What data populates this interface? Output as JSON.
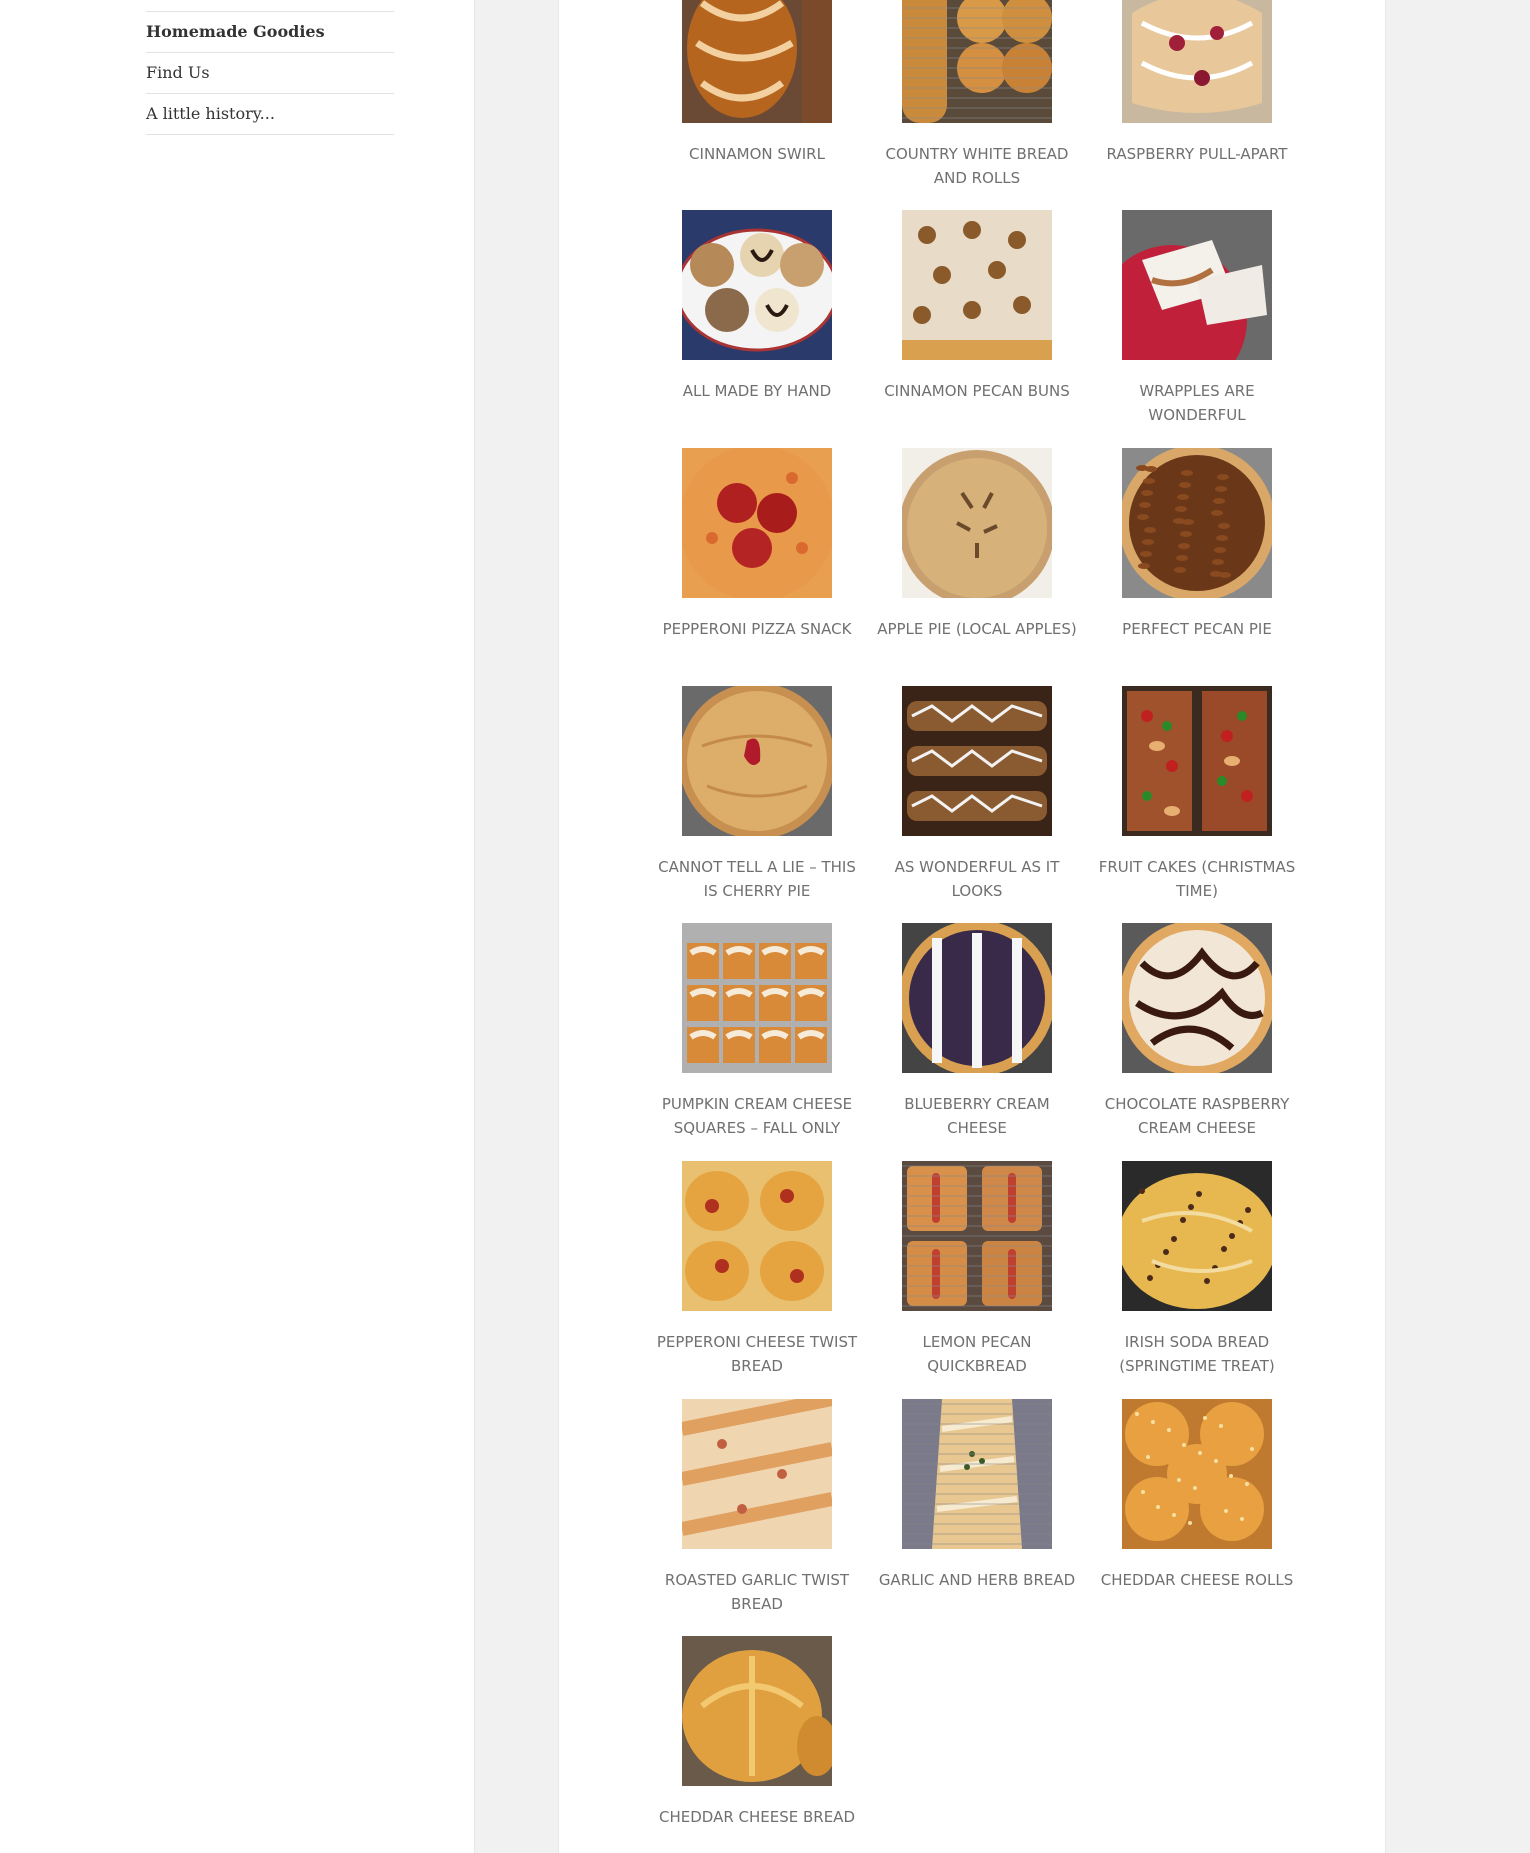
{
  "nav": {
    "items": [
      {
        "label": "Homemade Goodies",
        "current": true
      },
      {
        "label": "Find Us",
        "current": false
      },
      {
        "label": "A little history...",
        "current": false
      }
    ]
  },
  "gallery": {
    "items": [
      {
        "caption": "Cinnamon swirl",
        "icon": "cinnamon-swirl-photo"
      },
      {
        "caption": "Country white bread and rolls",
        "icon": "country-white-bread-photo"
      },
      {
        "caption": "Raspberry pull-apart",
        "icon": "raspberry-pull-apart-photo"
      },
      {
        "caption": "All made by hand",
        "icon": "cookies-plate-photo"
      },
      {
        "caption": "Cinnamon Pecan Buns",
        "icon": "cinnamon-pecan-buns-photo"
      },
      {
        "caption": "Wrapples are wonderful",
        "icon": "wrapples-photo"
      },
      {
        "caption": "Pepperoni Pizza Snack",
        "icon": "pepperoni-pizza-photo"
      },
      {
        "caption": "Apple pie (local apples)",
        "icon": "apple-pie-photo"
      },
      {
        "caption": "Perfect Pecan Pie",
        "icon": "pecan-pie-photo"
      },
      {
        "caption": "Cannot tell a lie – this is cherry pie",
        "icon": "cherry-pie-photo"
      },
      {
        "caption": "As wonderful as it looks",
        "icon": "chocolate-pastries-photo"
      },
      {
        "caption": "Fruit cakes (Christmas time)",
        "icon": "fruit-cakes-photo"
      },
      {
        "caption": "Pumpkin Cream Cheese Squares – fall only",
        "icon": "pumpkin-squares-photo"
      },
      {
        "caption": "Blueberry Cream Cheese",
        "icon": "blueberry-cream-cheese-photo"
      },
      {
        "caption": "Chocolate Raspberry Cream Cheese",
        "icon": "chocolate-raspberry-photo"
      },
      {
        "caption": "Pepperoni cheese twist bread",
        "icon": "pepperoni-twist-bread-photo"
      },
      {
        "caption": "Lemon pecan quickbread",
        "icon": "lemon-pecan-quickbread-photo"
      },
      {
        "caption": "Irish soda bread (springtime treat)",
        "icon": "irish-soda-bread-photo"
      },
      {
        "caption": "Roasted garlic twist bread",
        "icon": "garlic-twist-bread-photo"
      },
      {
        "caption": "Garlic and herb bread",
        "icon": "garlic-herb-bread-photo"
      },
      {
        "caption": "Cheddar Cheese Rolls",
        "icon": "cheddar-rolls-photo"
      },
      {
        "caption": "Cheddar cheese bread",
        "icon": "cheddar-bread-photo"
      }
    ]
  }
}
